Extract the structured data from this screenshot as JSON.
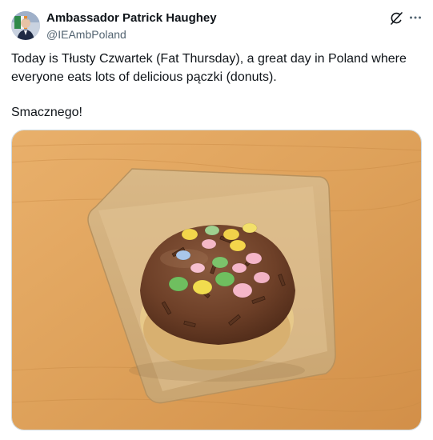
{
  "author": {
    "name": "Ambassador Patrick Haughey",
    "handle": "@IEAmbPoland",
    "avatar_icon": "profile-photo"
  },
  "tweet": {
    "text_line1": "Today is Tłusty Czwartek (Fat Thursday), a great day in Poland where everyone eats lots of delicious pączki (donuts).",
    "text_line2": "Smacznego!"
  },
  "actions": {
    "grok_icon": "grok-icon",
    "more_icon": "more-options-icon"
  },
  "media": {
    "description_icon": "donut-photo"
  },
  "colors": {
    "text_primary": "#0f1419",
    "text_secondary": "#536471",
    "border": "#cfd9de"
  }
}
